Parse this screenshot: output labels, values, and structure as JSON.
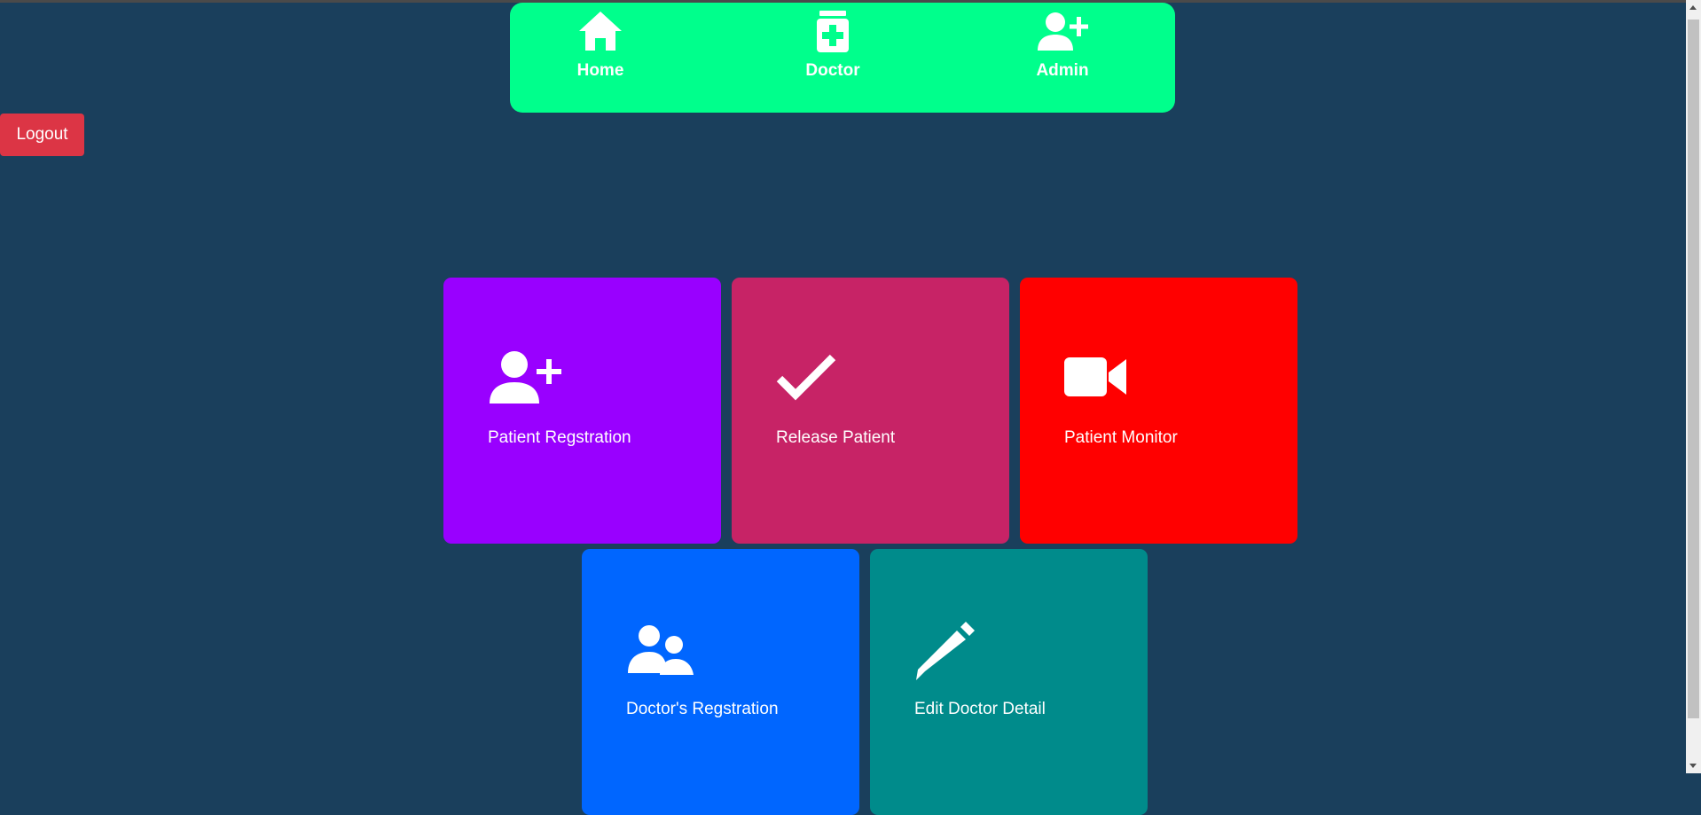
{
  "nav": {
    "items": [
      {
        "label": "Home",
        "icon": "home-icon"
      },
      {
        "label": "Doctor",
        "icon": "medicine-bottle-icon"
      },
      {
        "label": "Admin",
        "icon": "user-plus-icon"
      }
    ],
    "color": "#00ff8c"
  },
  "logout": {
    "label": "Logout",
    "color": "#dc3545"
  },
  "cards": [
    {
      "label": "Patient Regstration",
      "icon": "user-plus-icon",
      "color": "#9900ff"
    },
    {
      "label": "Release Patient",
      "icon": "check-icon",
      "color": "#c72366"
    },
    {
      "label": "Patient Monitor",
      "icon": "video-camera-icon",
      "color": "#ff0000"
    },
    {
      "label": "Doctor's Regstration",
      "icon": "users-icon",
      "color": "#0066ff"
    },
    {
      "label": "Edit Doctor Detail",
      "icon": "pencil-icon",
      "color": "#008b8b"
    }
  ],
  "background": "#1a3f5c"
}
